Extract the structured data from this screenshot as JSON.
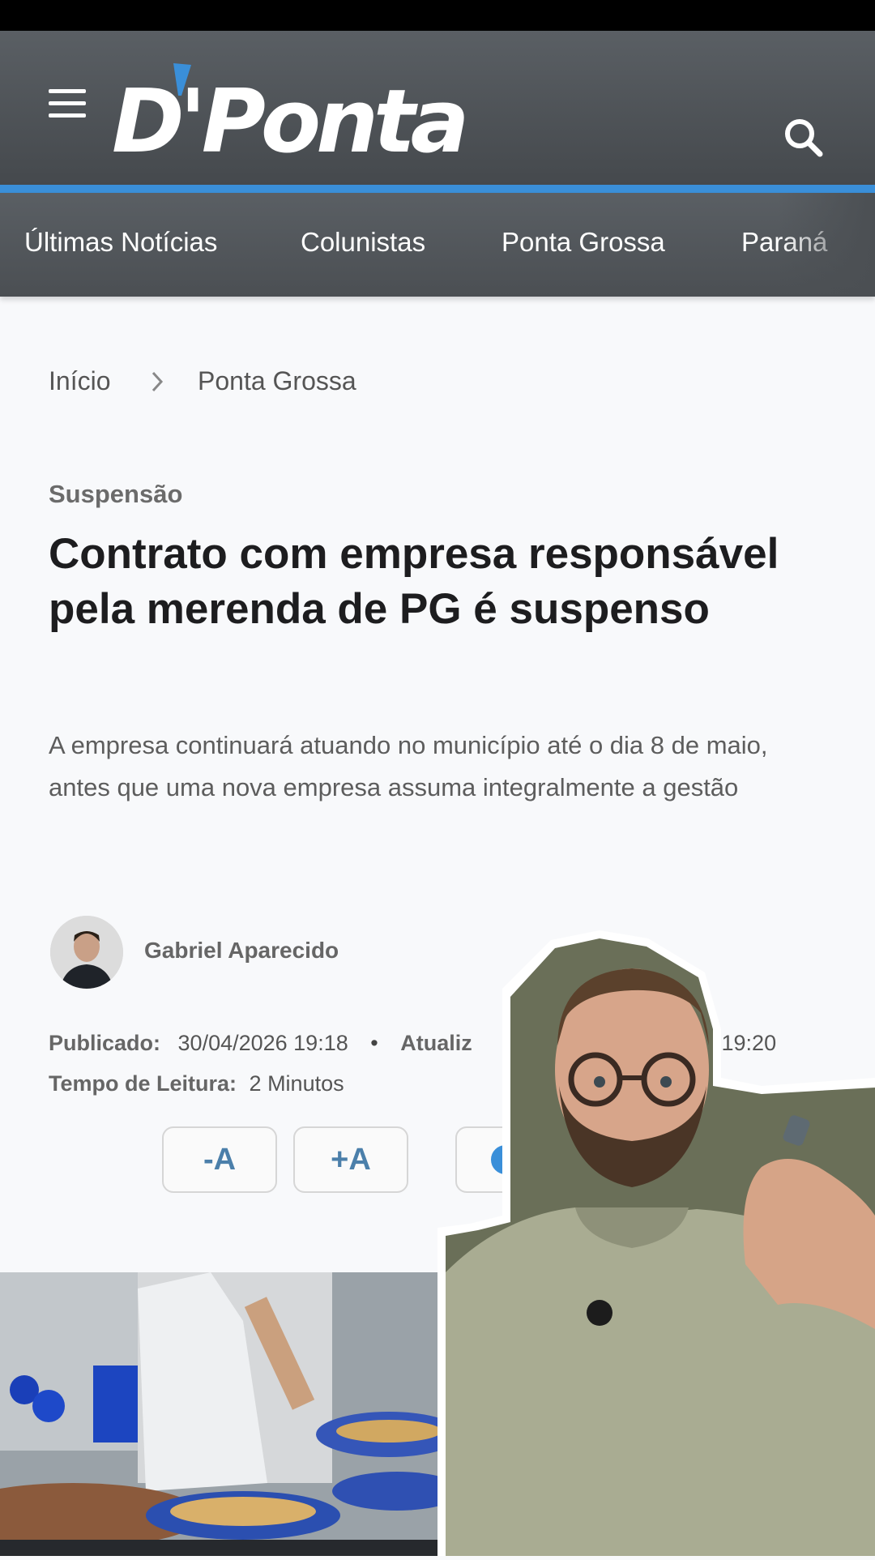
{
  "site": {
    "logo_text": "D'Ponta"
  },
  "nav": {
    "items": [
      "Últimas Notícias",
      "Colunistas",
      "Ponta Grossa",
      "Paraná"
    ]
  },
  "breadcrumb": {
    "home": "Início",
    "current": "Ponta Grossa"
  },
  "article": {
    "kicker": "Suspensão",
    "title": "Contrato com empresa responsável pela merenda de PG é suspenso",
    "lead": "A empresa continuará atuando no município até o dia 8 de maio, antes que uma nova empresa assuma integralmente a gestão",
    "author": "Gabriel Aparecido",
    "published_label": "Publicado:",
    "published_value": "30/04/2026 19:18",
    "bullet": "•",
    "updated_label": "Atualiz",
    "updated_value": "6 19:20",
    "reading_label": "Tempo de Leitura:",
    "reading_value": "2 Minutos"
  },
  "tools": {
    "font_decrease": "-A",
    "font_increase": "+A"
  },
  "colors": {
    "accent": "#3a8fd9",
    "header": "#4b4f53"
  }
}
